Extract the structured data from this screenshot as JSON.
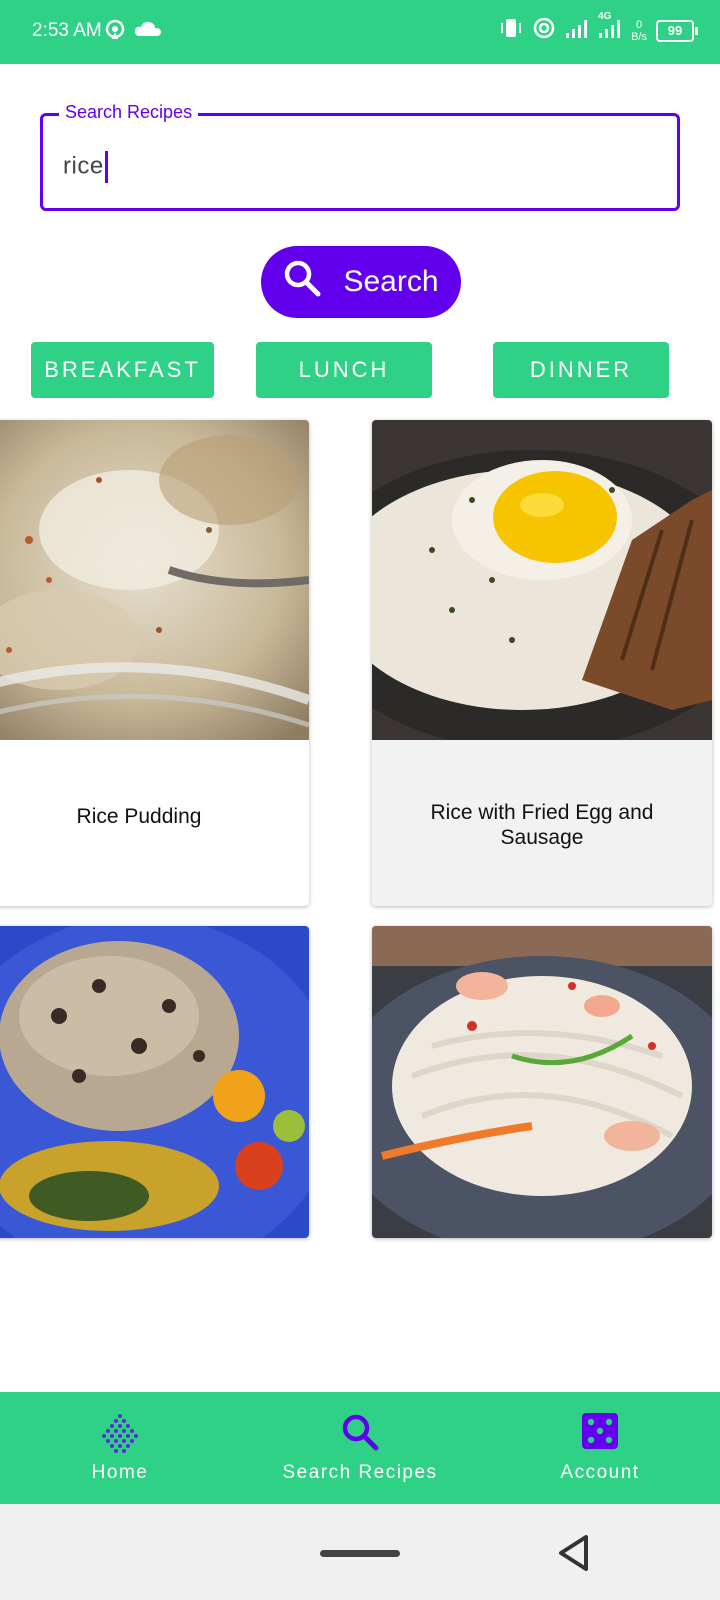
{
  "status_bar": {
    "time": "2:53 AM",
    "net_speed_value": "0",
    "net_speed_unit": "B/s",
    "network_type": "4G",
    "battery": "99"
  },
  "search": {
    "label": "Search Recipes",
    "value": "rice",
    "button_label": "Search"
  },
  "categories": [
    "BREAKFAST",
    "LUNCH",
    "DINNER"
  ],
  "recipes": [
    {
      "title": "Rice Pudding"
    },
    {
      "title": "Rice with Fried Egg and Sausage"
    },
    {
      "title": ""
    },
    {
      "title": ""
    }
  ],
  "bottom_nav": {
    "items": [
      {
        "label": "Home",
        "icon": "home-dots-icon"
      },
      {
        "label": "Search Recipes",
        "icon": "search-icon"
      },
      {
        "label": "Account",
        "icon": "dice-icon"
      }
    ],
    "active": "Search Recipes"
  },
  "colors": {
    "accent_green": "#2fd187",
    "primary_purple": "#6200ee"
  }
}
